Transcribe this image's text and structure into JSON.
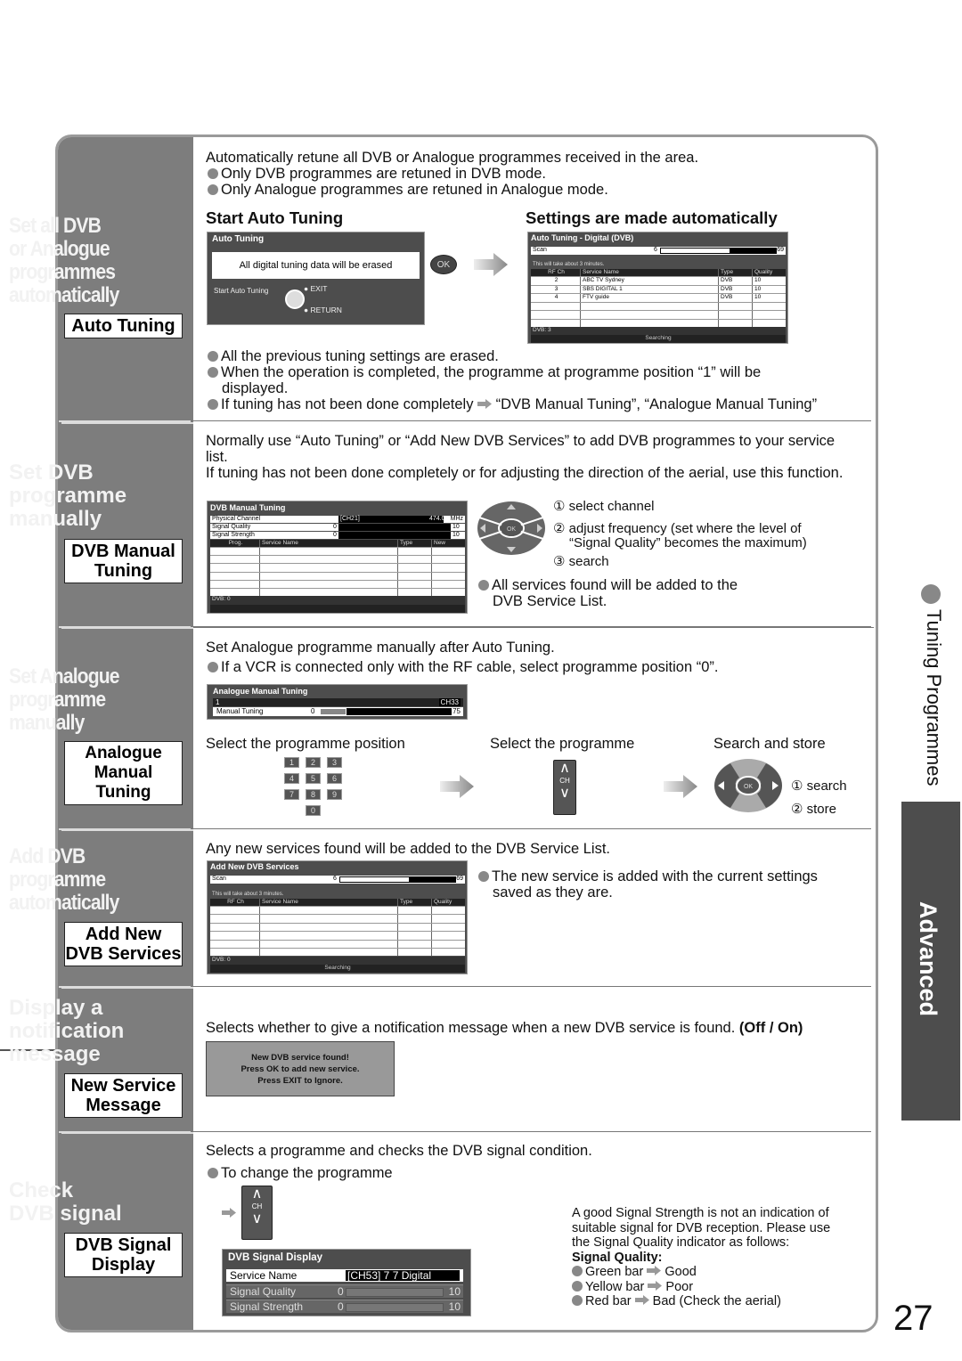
{
  "side": {
    "section_title": "Tuning Programmes",
    "tab_label": "Advanced",
    "page_number": "27"
  },
  "sections": {
    "auto": {
      "title": [
        "Set all DVB",
        "or Analogue",
        "programmes",
        "automatically"
      ],
      "label": "Auto Tuning",
      "intro": "Automatically retune all DVB or Analogue programmes received in the area.",
      "bullets_top": [
        "Only DVB programmes are retuned in DVB mode.",
        "Only Analogue programmes are retuned in Analogue mode."
      ],
      "step1_heading": "Start Auto Tuning",
      "step2_heading": "Settings are made automatically",
      "screen1": {
        "title": "Auto Tuning",
        "message": "All digital tuning data will be erased",
        "start_label": "Start Auto Tuning",
        "exit_label": "EXIT",
        "return_label": "RETURN"
      },
      "ok_label": "OK",
      "screen2": {
        "title": "Auto Tuning - Digital (DVB)",
        "scan_label": "Scan",
        "scan_from": "6",
        "scan_to": "69",
        "scan_progress": 0.6,
        "notice": "This will take about 3 minutes.",
        "columns": [
          "RF Ch",
          "Service Name",
          "Type",
          "Quality"
        ],
        "rows": [
          [
            "2",
            "ABC TV Sydney",
            "DVB",
            "10"
          ],
          [
            "3",
            "SBS DIGITAL 1",
            "DVB",
            "10"
          ],
          [
            "4",
            "FTV guide",
            "DVB",
            "10"
          ],
          [
            "",
            "",
            "",
            ""
          ],
          [
            "",
            "",
            "",
            ""
          ],
          [
            "",
            "",
            "",
            ""
          ]
        ],
        "count": "DVB: 3",
        "status": "Searching"
      },
      "bullets_bottom": [
        "All the previous tuning settings are erased.",
        "When the operation is completed, the programme at programme position “1” will be displayed.",
        "If tuning has not been done completely"
      ],
      "bottom_ref": "“DVB Manual Tuning”, “Analogue Manual Tuning”"
    },
    "dvb_manual": {
      "title": [
        "Set DVB",
        "programme",
        "manually"
      ],
      "label": [
        "DVB Manual",
        "Tuning"
      ],
      "intro1": "Normally use “Auto Tuning” or “Add New DVB Services” to add DVB programmes to your service list.",
      "intro2": "If tuning has not been done completely or for adjusting the direction of the aerial, use this function.",
      "screen": {
        "title": "DVB Manual Tuning",
        "rows": [
          {
            "label": "Physical Channel",
            "left": "[CH21]",
            "right": "474.00",
            "unit": "MHz"
          },
          {
            "label": "Signal Quality",
            "left": "0",
            "right": "10"
          },
          {
            "label": "Signal Strength",
            "left": "0",
            "right": "10"
          }
        ],
        "columns": [
          "Prog.",
          "Service Name",
          "Type",
          "New"
        ],
        "count": "DVB: 0"
      },
      "steps": [
        "① select channel",
        "② adjust frequency (set where the level of",
        "“Signal Quality” becomes the maximum)",
        "③ search"
      ],
      "ok_label": "OK",
      "note": [
        "All services found will be added to the",
        "DVB Service List."
      ]
    },
    "analogue_manual": {
      "title": [
        "Set Analogue",
        "programme",
        "manually"
      ],
      "label": [
        "Analogue",
        "Manual Tuning"
      ],
      "intro": "Set Analogue programme manually after Auto Tuning.",
      "bullet": "If a VCR is connected only with the RF cable, select programme position “0”.",
      "screen": {
        "title": "Analogue Manual Tuning",
        "position": "1",
        "channel": "CH33",
        "row_label": "Manual Tuning",
        "min": "0",
        "max": "75",
        "progress": 0.2
      },
      "step1": "Select the programme position",
      "step2": "Select the programme",
      "step3": "Search and store",
      "keypad": [
        "1",
        "2",
        "3",
        "4",
        "5",
        "6",
        "7",
        "8",
        "9",
        "0"
      ],
      "ch_label": "CH",
      "ok_label": "OK",
      "pad_steps": [
        "① search",
        "② store"
      ]
    },
    "add_dvb": {
      "title": [
        "Add DVB",
        "programme",
        "automatically"
      ],
      "label": [
        "Add New",
        "DVB Services"
      ],
      "intro": "Any new services found will be added to the DVB Service List.",
      "screen": {
        "title": "Add New DVB Services",
        "scan_label": "Scan",
        "scan_from": "6",
        "scan_to": "69",
        "scan_progress": 0.6,
        "notice": "This will take about 3 minutes.",
        "columns": [
          "RF Ch",
          "Service Name",
          "Type",
          "Quality"
        ],
        "count": "DVB: 0",
        "status": "Searching"
      },
      "note": [
        "The new service is added with the current settings",
        "saved as they are."
      ]
    },
    "notify": {
      "title": [
        "Display a",
        "notification",
        "message"
      ],
      "label": [
        "New Service",
        "Message"
      ],
      "intro": "Selects whether to give a notification message when a new DVB service is found.",
      "options": "(Off / On)",
      "popup": [
        "New DVB service found!",
        "Press OK to add new service.",
        "Press EXIT to Ignore."
      ]
    },
    "signal": {
      "title": [
        "Check",
        "DVB signal"
      ],
      "label": [
        "DVB Signal",
        "Display"
      ],
      "intro": "Selects a programme and checks the DVB signal condition.",
      "bullet": "To change the programme",
      "ch_label": "CH",
      "screen": {
        "title": "DVB Signal Display",
        "rows": [
          {
            "label": "Service Name",
            "value": "[CH53] 7 7 Digital"
          },
          {
            "label": "Signal Quality",
            "left": "0",
            "right": "10"
          },
          {
            "label": "Signal Strength",
            "left": "0",
            "right": "10"
          }
        ]
      },
      "note": [
        "A good Signal Strength is not an indication of",
        "suitable signal for DVB reception. Please use",
        "the Signal Quality indicator as follows:"
      ],
      "quality_heading": "Signal Quality:",
      "quality_items": [
        {
          "bar": "Green bar",
          "meaning": "Good"
        },
        {
          "bar": "Yellow bar",
          "meaning": "Poor"
        },
        {
          "bar": "Red bar",
          "meaning": "Bad (Check the aerial)"
        }
      ]
    }
  }
}
